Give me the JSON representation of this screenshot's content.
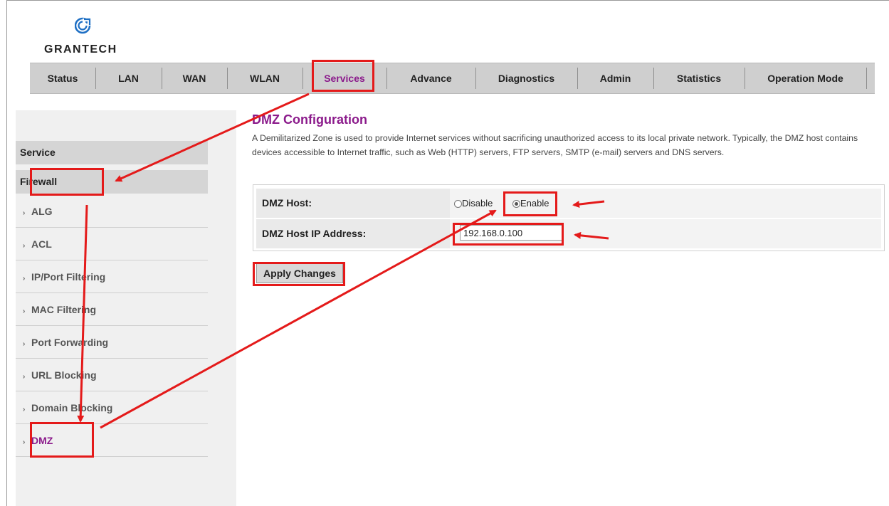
{
  "brand": {
    "name": "GRANTECH"
  },
  "nav": {
    "items": [
      {
        "label": "Status"
      },
      {
        "label": "LAN"
      },
      {
        "label": "WAN"
      },
      {
        "label": "WLAN"
      },
      {
        "label": "Services"
      },
      {
        "label": "Advance"
      },
      {
        "label": "Diagnostics"
      },
      {
        "label": "Admin"
      },
      {
        "label": "Statistics"
      },
      {
        "label": "Operation Mode"
      }
    ],
    "active": "Services"
  },
  "sidebar": {
    "service_label": "Service",
    "firewall_label": "Firewall",
    "items": [
      {
        "label": "ALG"
      },
      {
        "label": "ACL"
      },
      {
        "label": "IP/Port Filtering"
      },
      {
        "label": "MAC Filtering"
      },
      {
        "label": "Port Forwarding"
      },
      {
        "label": "URL Blocking"
      },
      {
        "label": "Domain Blocking"
      },
      {
        "label": "DMZ"
      }
    ],
    "active": "DMZ"
  },
  "main": {
    "title": "DMZ Configuration",
    "description": "A Demilitarized Zone is used to provide Internet services without sacrificing unauthorized access to its local private network. Typically, the DMZ host contains devices accessible to Internet traffic, such as Web (HTTP) servers, FTP servers, SMTP (e-mail) servers and DNS servers.",
    "dmz_host_label": "DMZ Host:",
    "disable_label": "Disable",
    "enable_label": "Enable",
    "dmz_enabled": true,
    "ip_label": "DMZ Host IP Address:",
    "ip_value": "192.168.0.100",
    "apply_label": "Apply Changes"
  },
  "annotation_color": "#e41a1a",
  "accent_color": "#8b1a8b"
}
